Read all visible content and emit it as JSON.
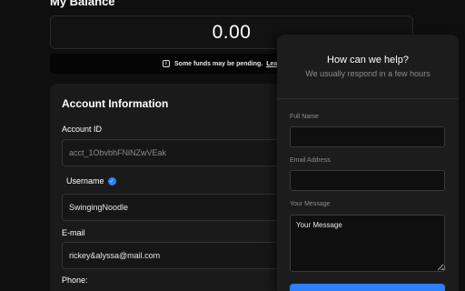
{
  "balance": {
    "title": "My Balance",
    "amount": "0.00",
    "pending_notice": "Some funds may be pending.",
    "pending_link": "Learn m",
    "info_icon": "i"
  },
  "account": {
    "section_title": "Account Information",
    "account_id_label": "Account ID",
    "account_id_value": "acct_1ObvbhFNiNZwVEak",
    "username_label": "Username",
    "username_value": "SwingingNoodle",
    "verified_mark": "✓",
    "email_label": "E-mail",
    "email_value": "rickey&alyssa@mail.com",
    "phone_label": "Phone:"
  },
  "help_widget": {
    "title": "How can we help?",
    "subtitle": "We usually respond in a few hours",
    "full_name_label": "Full Name",
    "email_label": "Email Address",
    "message_label": "Your Message",
    "message_placeholder": "Your Message",
    "full_name_value": "",
    "email_value": ""
  },
  "colors": {
    "accent": "#2d7ff9",
    "background": "#0f0f0f",
    "card": "#1a1a1a",
    "panel": "#1c1c1c"
  }
}
